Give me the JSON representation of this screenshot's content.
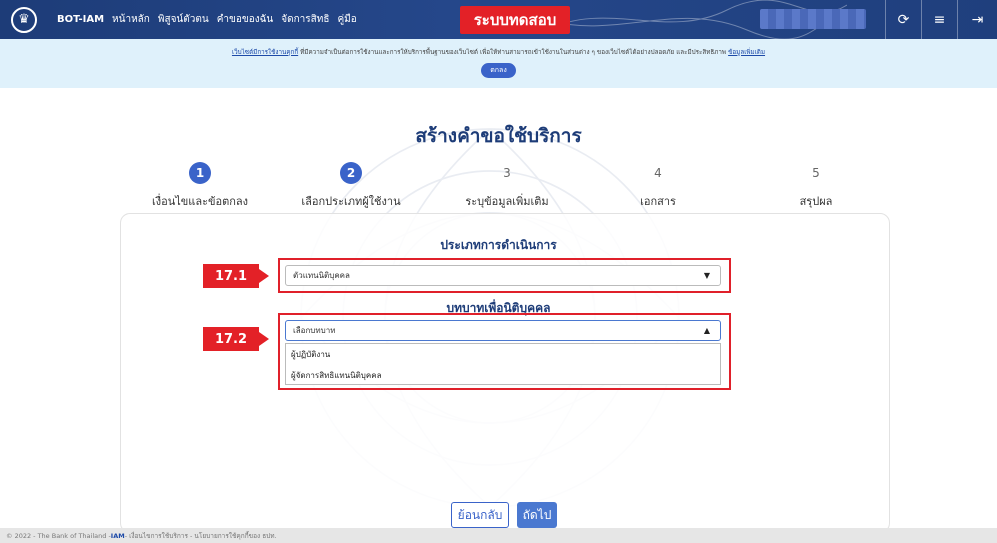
{
  "header": {
    "brand": "BOT-IAM",
    "nav": [
      "หน้าหลัก",
      "พิสูจน์ตัวตน",
      "คำขอของฉัน",
      "จัดการสิทธิ",
      "คู่มือ"
    ],
    "test_banner": "ระบบทดสอบ",
    "icons": [
      "refresh-icon",
      "menu-edit-icon",
      "logout-icon"
    ]
  },
  "notice": {
    "link_text": "เว็บไซต์มีการใช้งานคุกกี้",
    "text": " ที่มีความจำเป็นต่อการใช้งานและการให้บริการพื้นฐานของเว็บไซต์ เพื่อให้ท่านสามารถเข้าใช้งานในส่วนต่าง ๆ ของเว็บไซต์ได้อย่างปลอดภัย และมีประสิทธิภาพ ",
    "more_link": "ข้อมูลเพิ่มเติม",
    "ok_button": "ตกลง"
  },
  "page": {
    "title": "สร้างคำขอใช้บริการ",
    "steps": [
      {
        "number": "1",
        "label": "เงื่อนไขและข้อตกลง",
        "state": "done"
      },
      {
        "number": "2",
        "label": "เลือกประเภทผู้ใช้งาน",
        "state": "current"
      },
      {
        "number": "3",
        "label": "ระบุข้อมูลเพิ่มเติม",
        "state": "todo"
      },
      {
        "number": "4",
        "label": "เอกสาร",
        "state": "todo"
      },
      {
        "number": "5",
        "label": "สรุปผล",
        "state": "todo"
      }
    ]
  },
  "form": {
    "operation_type_title": "ประเภทการดำเนินการ",
    "operation_type_value": "ตัวแทนนิติบุคคล",
    "role_title": "บทบาทเพื่อนิติบุคคล",
    "role_placeholder": "เลือกบทบาท",
    "role_options": [
      "ผู้ปฏิบัติงาน",
      "ผู้จัดการสิทธิแทนนิติบุคคล"
    ]
  },
  "callouts": {
    "first": "17.1",
    "second": "17.2"
  },
  "buttons": {
    "back": "ย้อนกลับ",
    "next": "ถัดไป"
  },
  "footer": {
    "copyright": "© 2022 - The Bank of Thailand - ",
    "iam": "IAM",
    "links": " - เงื่อนไขการใช้บริการ - นโยบายการใช้คุกกี้ของ ธปท."
  },
  "colors": {
    "primary": "#1d3c78",
    "accent": "#3a63c9",
    "highlight": "#e32127",
    "notice_bg": "#dff1fb"
  }
}
